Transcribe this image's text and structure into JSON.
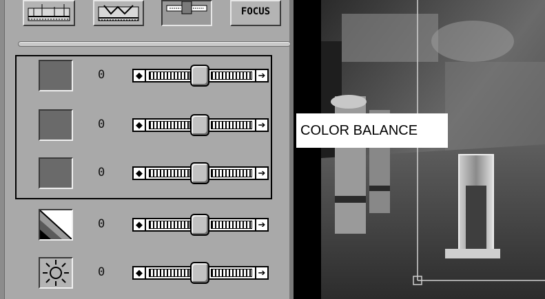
{
  "toolbar": {
    "buttons": [
      {
        "name": "histogram-icon"
      },
      {
        "name": "tonal-curve-icon"
      },
      {
        "name": "adjust-sliders-icon"
      },
      {
        "name": "focus",
        "label": "FOCUS"
      }
    ]
  },
  "adjustments": [
    {
      "icon": "color-swatch-icon",
      "value": "0",
      "level": 0.5
    },
    {
      "icon": "color-swatch-icon",
      "value": "0",
      "level": 0.5
    },
    {
      "icon": "color-swatch-icon",
      "value": "0",
      "level": 0.5
    },
    {
      "icon": "contrast-icon",
      "value": "0",
      "level": 0.5
    },
    {
      "icon": "brightness-sun-icon",
      "value": "0",
      "level": 0.5
    }
  ],
  "photo": {
    "overlay_label": "COLOR BALANCE"
  },
  "colors": {
    "panel_bg": "#a9a9a9",
    "photo_bg": "#000000"
  }
}
